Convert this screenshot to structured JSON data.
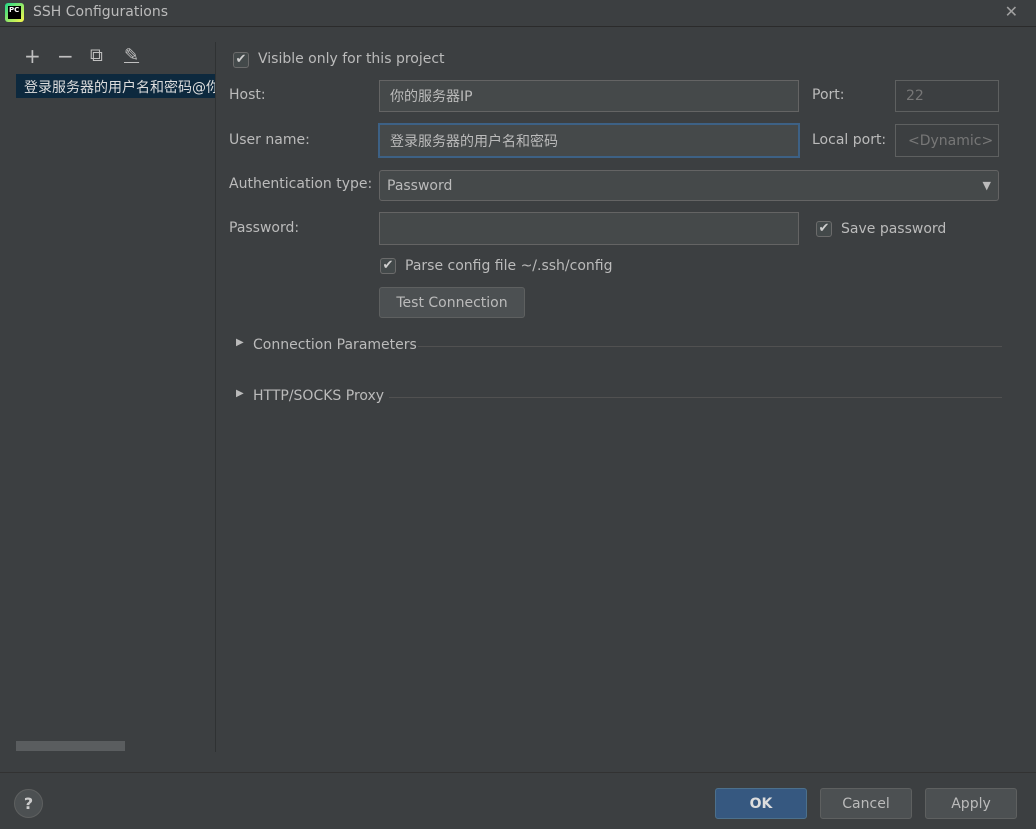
{
  "window": {
    "title": "SSH Configurations",
    "logo_text": "PC"
  },
  "toolbar": {
    "add": "+",
    "remove": "−",
    "copy": "⧉",
    "edit": "✎"
  },
  "sidebar": {
    "items": [
      {
        "label": "登录服务器的用户名和密码@你的服务器IP",
        "selected": true
      }
    ]
  },
  "form": {
    "visible_only": {
      "label": "Visible only for this project",
      "checked": true
    },
    "host": {
      "label": "Host:",
      "value": "你的服务器IP"
    },
    "port": {
      "label": "Port:",
      "value": "22"
    },
    "user": {
      "label": "User name:",
      "value": "登录服务器的用户名和密码"
    },
    "local_port": {
      "label": "Local port:",
      "placeholder": "<Dynamic>"
    },
    "auth": {
      "label": "Authentication type:",
      "value": "Password"
    },
    "password": {
      "label": "Password:",
      "value": ""
    },
    "save_password": {
      "label": "Save password",
      "checked": true
    },
    "parse_config": {
      "label": "Parse config file ~/.ssh/config",
      "checked": true
    },
    "test_connection": "Test Connection"
  },
  "sections": [
    {
      "label": "Connection Parameters",
      "expanded": false
    },
    {
      "label": "HTTP/SOCKS Proxy",
      "expanded": false
    }
  ],
  "footer": {
    "help": "?",
    "ok": "OK",
    "cancel": "Cancel",
    "apply": "Apply"
  },
  "colors": {
    "background": "#3c3f41",
    "selection": "#0d293e",
    "ok_button": "#365880",
    "focus": "#3d6185"
  }
}
